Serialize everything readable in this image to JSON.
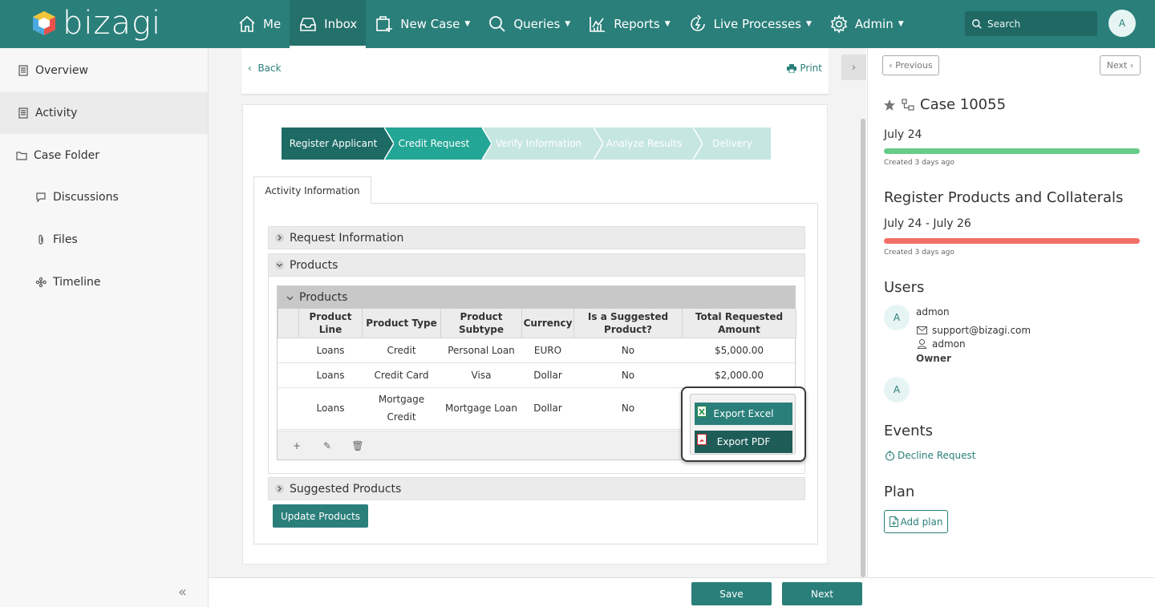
{
  "brand": {
    "name": "bizagi"
  },
  "nav": {
    "items": [
      {
        "label": "Me",
        "icon": "home-icon"
      },
      {
        "label": "Inbox",
        "icon": "inbox-icon"
      },
      {
        "label": "New Case",
        "icon": "new-case-icon"
      },
      {
        "label": "Queries",
        "icon": "search-icon"
      },
      {
        "label": "Reports",
        "icon": "reports-icon"
      },
      {
        "label": "Live Processes",
        "icon": "live-processes-icon"
      },
      {
        "label": "Admin",
        "icon": "gear-icon"
      }
    ],
    "active": "Inbox",
    "search_placeholder": "Search",
    "user_initial": "A"
  },
  "sidebar": {
    "items": [
      {
        "label": "Overview",
        "icon": "document-icon"
      },
      {
        "label": "Activity",
        "icon": "document-icon"
      },
      {
        "label": "Case Folder",
        "icon": "folder-icon"
      },
      {
        "label": "Discussions",
        "icon": "chat-icon"
      },
      {
        "label": "Files",
        "icon": "paperclip-icon"
      },
      {
        "label": "Timeline",
        "icon": "timeline-icon"
      }
    ],
    "active": "Activity",
    "collapse_glyph": "«"
  },
  "main": {
    "back_label": "Back",
    "print_label": "Print",
    "stepper": [
      {
        "label": "Register Applicant",
        "state": "done"
      },
      {
        "label": "Credit Request",
        "state": "current"
      },
      {
        "label": "Verify Information",
        "state": "pending"
      },
      {
        "label": "Analyze Results",
        "state": "pending"
      },
      {
        "label": "Delivery",
        "state": "pending"
      }
    ],
    "tab_label": "Activity Information",
    "groups": {
      "request_info": "Request Information",
      "products": "Products",
      "suggested": "Suggested Products"
    },
    "grid": {
      "title": "Products",
      "columns": [
        "Product Line",
        "Product Type",
        "Product Subtype",
        "Currency",
        "Is a Suggested Product?",
        "Total Requested Amount"
      ],
      "rows": [
        [
          "Loans",
          "Credit",
          "Personal Loan",
          "EURO",
          "No",
          "$5,000.00"
        ],
        [
          "Loans",
          "Credit Card",
          "Visa",
          "Dollar",
          "No",
          "$2,000.00"
        ],
        [
          "Loans",
          "Mortgage Credit",
          "Mortgage Loan",
          "Dollar",
          "No",
          ""
        ]
      ],
      "footer_actions": [
        "+",
        "✎",
        "🗑"
      ]
    },
    "export": {
      "excel_label": "Export Excel",
      "pdf_label": "Export PDF"
    },
    "update_button": "Update Products"
  },
  "footer": {
    "save_label": "Save",
    "next_label": "Next"
  },
  "case_panel": {
    "previous_label": "Previous",
    "next_label": "Next",
    "case_title": "Case 10055",
    "case_date": "July 24",
    "case_created": "Created 3 days ago",
    "case_progress_color": "#66cc88",
    "task_title": "Register Products and Collaterals",
    "task_dates": "July 24 - July 26",
    "task_created": "Created 3 days ago",
    "task_progress_color": "#f07068",
    "users_heading": "Users",
    "users": [
      {
        "initial": "A",
        "name": "admon",
        "email": "support@bizagi.com",
        "login": "admon",
        "role": "Owner"
      },
      {
        "initial": "A"
      }
    ],
    "events_heading": "Events",
    "event_link": "Decline Request",
    "plan_heading": "Plan",
    "add_plan_label": "Add plan"
  },
  "colors": {
    "primary": "#2a7f7a",
    "step_done": "#1e6b66",
    "step_current": "#23a695",
    "step_pending": "#c6e6e2"
  }
}
